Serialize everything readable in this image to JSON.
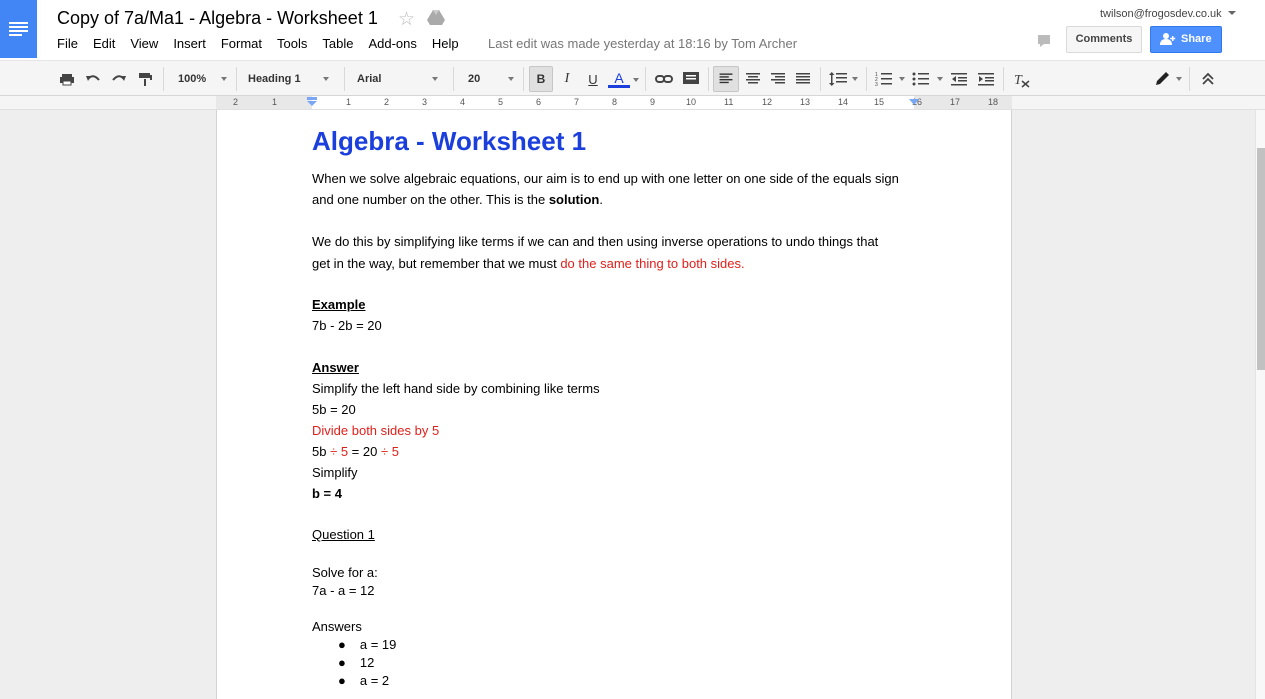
{
  "header": {
    "title": "Copy of 7a/Ma1 - Algebra - Worksheet 1",
    "last_edit": "Last edit was made yesterday at 18:16 by Tom Archer",
    "account": "twilson@frogosdev.co.uk",
    "comments_label": "Comments",
    "share_label": "Share",
    "brand_color": "#4285f4",
    "share_color": "#4d90fe"
  },
  "menu": [
    "File",
    "Edit",
    "View",
    "Insert",
    "Format",
    "Tools",
    "Table",
    "Add-ons",
    "Help"
  ],
  "toolbar": {
    "zoom": "100%",
    "style": "Heading 1",
    "font": "Arial",
    "size": "20",
    "bold": "B",
    "italic": "I",
    "underline": "U",
    "text_color": "A",
    "text_color_value": "#1a3fdc"
  },
  "ruler": {
    "labels": [
      "2",
      "1",
      "1",
      "2",
      "3",
      "4",
      "5",
      "6",
      "7",
      "8",
      "9",
      "10",
      "11",
      "12",
      "13",
      "14",
      "15",
      "16",
      "17",
      "18"
    ]
  },
  "document": {
    "heading": "Algebra - Worksheet 1",
    "heading_color": "#1a3fdc",
    "p1_line1": "When we solve algebraic equations, our aim is to end up with one letter on one side of the equals sign",
    "p1_line2_pre": "and one number on the other.  This is the ",
    "p1_line2_bold": "solution",
    "p1_line2_post": ".",
    "p2_line1": "We do this by simplifying like terms if we can and then using inverse operations to undo things that",
    "p2_line2_pre": "get in the way, but remember that we must ",
    "p2_line2_red": "do the same thing to both sides",
    "p2_line2_post": ".",
    "accent_red": "#e0201b",
    "example_heading": "Example",
    "example_eq": "7b - 2b = 20",
    "answer_heading": "Answer",
    "answer_line1": "Simplify the left hand side by combining like terms",
    "answer_line2": "5b = 20",
    "answer_line3": "Divide both sides by 5",
    "answer_line4_a": "5b ",
    "answer_line4_b": "÷ 5",
    "answer_line4_c": " = 20 ",
    "answer_line4_d": "÷ 5",
    "answer_line5": "Simplify",
    "answer_line6": "b = 4",
    "question_heading": "Question 1",
    "question_prompt": "Solve for a:",
    "question_eq": "7a - a = 12",
    "answers_label": "Answers",
    "answers": [
      "a = 19",
      "12",
      "a = 2"
    ]
  }
}
